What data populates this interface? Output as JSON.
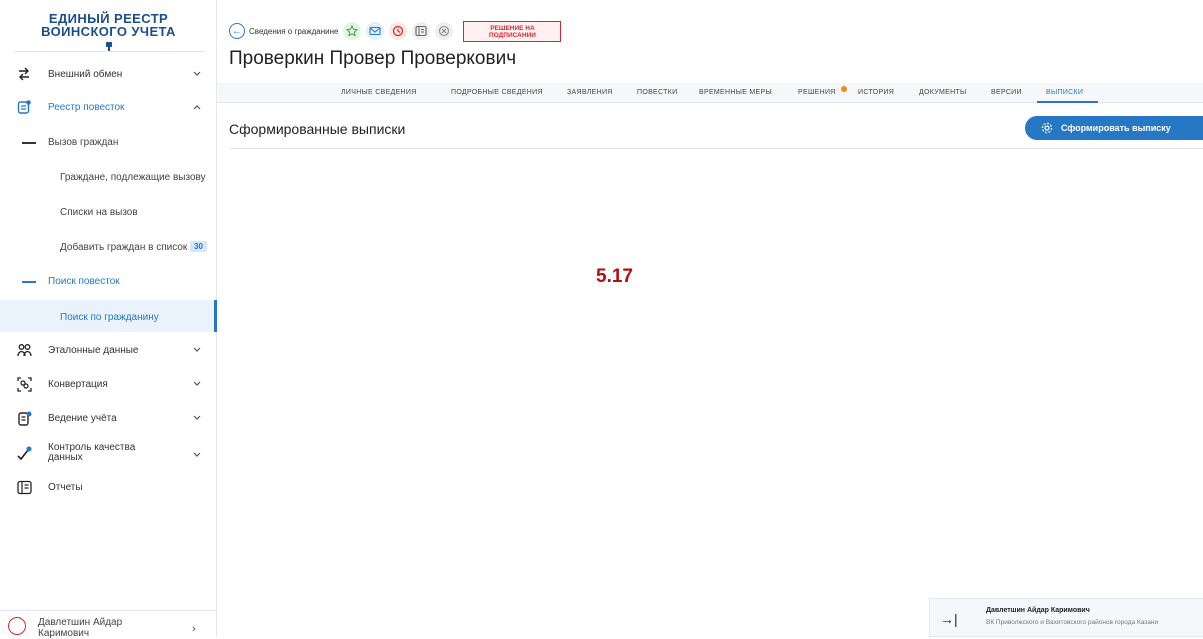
{
  "brand": {
    "line1": "ЕДИНЫЙ РЕЕСТР",
    "line2": "ВОИНСКОГО УЧЕТА"
  },
  "sidebar": {
    "items": [
      {
        "label": "Внешний обмен",
        "icon": "exchange-arrows-icon"
      },
      {
        "label": "Реестр повесток",
        "icon": "notice-document-icon"
      },
      {
        "label": "Вызов граждан"
      },
      {
        "label": "Граждане, подлежащие вызову"
      },
      {
        "label": "Списки на вызов"
      },
      {
        "label": "Добавить граждан в список",
        "badge": "30"
      },
      {
        "label": "Поиск повесток"
      },
      {
        "label": "Поиск по гражданину"
      },
      {
        "label": "Эталонные данные",
        "icon": "people-group-icon"
      },
      {
        "label": "Конвертация",
        "icon": "convert-scan-icon"
      },
      {
        "label": "Ведение учёта",
        "icon": "ledger-icon"
      },
      {
        "label": "Контроль качества данных",
        "icon": "quality-check-icon"
      },
      {
        "label": "Отчеты",
        "icon": "report-book-icon"
      }
    ],
    "user": "Давлетшин Айдар Каримович"
  },
  "toolbar": {
    "breadcrumb": "Сведения о гражданине",
    "status": {
      "line1": "РЕШЕНИЕ НА",
      "line2": "ПОДПИСАНИИ"
    }
  },
  "person": {
    "name": "Проверкин Провер Проверкович"
  },
  "tabs": [
    "ЛИЧНЫЕ СВЕДЕНИЯ",
    "ПОДРОБНЫЕ СВЕДЕНИЯ",
    "ЗАЯВЛЕНИЯ",
    "ПОВЕСТКИ",
    "ВРЕМЕННЫЕ МЕРЫ",
    "РЕШЕНИЯ",
    "ИСТОРИЯ",
    "ДОКУМЕНТЫ",
    "ВЕРСИИ",
    "ВЫПИСКИ"
  ],
  "section": {
    "title": "Сформированные выписки",
    "button": "Сформировать выписку"
  },
  "marker": "5.17",
  "footer": {
    "name": "Давлетшин Айдар Каримович",
    "org": "ВК Приволжского и Вахитовского районов города Казани"
  },
  "colors": {
    "accent": "#2778c4",
    "brand": "#1b4f8c",
    "alert": "#d7282e",
    "marker": "#b20f0f",
    "dot": "#f28b1d"
  }
}
